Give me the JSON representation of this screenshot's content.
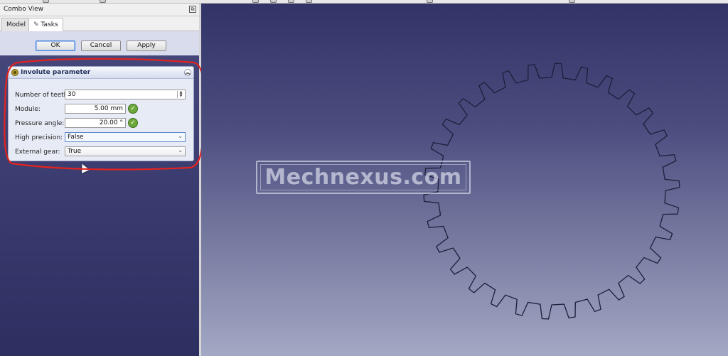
{
  "panel": {
    "title": "Combo View",
    "float_icon": "float-window-icon",
    "tabs": [
      {
        "label": "Model",
        "active": false
      },
      {
        "label": "Tasks",
        "active": true,
        "icon": "wrench-icon"
      }
    ]
  },
  "dialog": {
    "ok_label": "OK",
    "cancel_label": "Cancel",
    "apply_label": "Apply"
  },
  "params": {
    "header": "Involute parameter",
    "header_icon": "gear-icon",
    "teeth_label": "Number of teeth:",
    "teeth_value": "30",
    "module_label": "Module:",
    "module_value": "5.00 mm",
    "pressure_label": "Pressure angle:",
    "pressure_value": "20.00 °",
    "precision_label": "High precision:",
    "precision_value": "False",
    "external_label": "External gear:",
    "external_value": "True"
  },
  "viewport": {
    "watermark": "Mechnexus.com",
    "gear_teeth": 30
  },
  "colors": {
    "annotation": "#e3231f",
    "gear_outline": "#1c1f3a",
    "accept_icon": "#6ca83a"
  }
}
